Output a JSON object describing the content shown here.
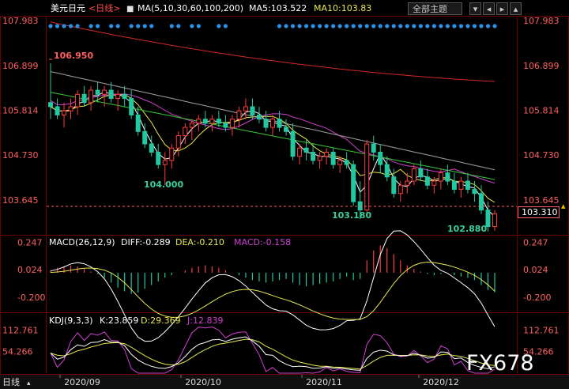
{
  "header": {
    "symbol": "美元日元",
    "period_link": "<日线>",
    "ma_label": "MA(5,10,30,60,100,200)",
    "ma5_label": "MA5:103.522",
    "ma10_label": "MA10:103.83",
    "theme_button": "全部主题",
    "window_buttons": [
      "▾",
      "◂",
      "▸",
      "▴"
    ]
  },
  "main_panel": {
    "y_ticks": [
      "107.983",
      "106.899",
      "105.814",
      "104.730",
      "103.645"
    ],
    "high_label": "106.950",
    "low_labels": [
      "104.000",
      "103.180",
      "102.880"
    ],
    "current_price": "103.310"
  },
  "macd_panel": {
    "title": "MACD(26,12,9)",
    "diff": "DIFF:-0.289",
    "dea": "DEA:-0.210",
    "macd": "MACD:-0.158",
    "y_ticks": [
      "0.247",
      "0.024",
      "-0.200"
    ]
  },
  "kdj_panel": {
    "title": "KDJ(9,3,3)",
    "k": "K:23.859",
    "d": "D:29.369",
    "j": "J:12.839",
    "y_ticks": [
      "112.761",
      "54.266"
    ]
  },
  "footer": {
    "period_tab": "日线",
    "x_labels": [
      "2020/09",
      "2020/10",
      "2020/11",
      "2020/12"
    ],
    "watermark": "FX678"
  },
  "colors": {
    "up": "#ff3c3c",
    "down": "#22c8a0",
    "ma5": "#ffffff",
    "ma10": "#e8e84a",
    "ma30": "#d040d0",
    "ma60": "#35c835",
    "ma100": "#a0a0a0",
    "ma200": "#d02828",
    "axis_text": "#ff6060",
    "grid": "#5a0000"
  },
  "chart_data": [
    {
      "type": "candlestick",
      "title": "美元日元 <日线>",
      "x_labels": [
        "2020/09",
        "2020/10",
        "2020/11",
        "2020/12"
      ],
      "ylim": [
        102.8,
        108.1
      ],
      "annotations": [
        {
          "text": "106.950",
          "value": 106.95
        },
        {
          "text": "104.000",
          "value": 104.0
        },
        {
          "text": "103.180",
          "value": 103.18
        },
        {
          "text": "102.880",
          "value": 102.88
        }
      ],
      "ohlc": [
        [
          106.0,
          106.95,
          105.6,
          105.9
        ],
        [
          105.9,
          106.1,
          105.6,
          105.7
        ],
        [
          105.7,
          106.0,
          105.4,
          105.8
        ],
        [
          105.8,
          106.1,
          105.6,
          105.9
        ],
        [
          105.9,
          106.3,
          105.7,
          106.2
        ],
        [
          106.2,
          106.4,
          105.9,
          106.0
        ],
        [
          106.0,
          106.4,
          105.8,
          106.3
        ],
        [
          106.3,
          106.5,
          106.0,
          106.2
        ],
        [
          106.2,
          106.4,
          105.9,
          106.3
        ],
        [
          106.3,
          106.5,
          106.0,
          106.1
        ],
        [
          106.1,
          106.3,
          105.8,
          106.2
        ],
        [
          106.2,
          106.4,
          105.9,
          106.1
        ],
        [
          106.1,
          106.3,
          105.6,
          105.7
        ],
        [
          105.7,
          105.9,
          105.2,
          105.3
        ],
        [
          105.3,
          105.5,
          104.9,
          105.0
        ],
        [
          105.0,
          105.2,
          104.7,
          104.8
        ],
        [
          104.8,
          105.0,
          104.4,
          104.5
        ],
        [
          104.5,
          104.8,
          104.0,
          104.6
        ],
        [
          104.6,
          105.0,
          104.4,
          104.9
        ],
        [
          104.9,
          105.3,
          104.7,
          105.2
        ],
        [
          105.2,
          105.5,
          105.0,
          105.4
        ],
        [
          105.4,
          105.6,
          105.1,
          105.5
        ],
        [
          105.5,
          105.7,
          105.3,
          105.6
        ],
        [
          105.6,
          105.8,
          105.4,
          105.5
        ],
        [
          105.5,
          105.7,
          105.3,
          105.6
        ],
        [
          105.6,
          105.8,
          105.4,
          105.5
        ],
        [
          105.5,
          105.7,
          105.3,
          105.4
        ],
        [
          105.4,
          105.7,
          105.2,
          105.6
        ],
        [
          105.6,
          105.9,
          105.4,
          105.8
        ],
        [
          105.8,
          106.1,
          105.6,
          105.9
        ],
        [
          105.9,
          106.1,
          105.6,
          105.7
        ],
        [
          105.7,
          105.9,
          105.5,
          105.6
        ],
        [
          105.6,
          105.8,
          105.3,
          105.4
        ],
        [
          105.4,
          105.7,
          105.2,
          105.6
        ],
        [
          105.6,
          105.8,
          105.3,
          105.4
        ],
        [
          105.4,
          105.6,
          105.2,
          105.3
        ],
        [
          105.3,
          105.5,
          104.6,
          104.7
        ],
        [
          104.7,
          105.0,
          104.5,
          104.9
        ],
        [
          104.9,
          105.1,
          104.6,
          104.8
        ],
        [
          104.8,
          105.0,
          104.5,
          104.6
        ],
        [
          104.6,
          104.8,
          104.4,
          104.7
        ],
        [
          104.7,
          104.9,
          104.5,
          104.8
        ],
        [
          104.8,
          104.9,
          104.4,
          104.5
        ],
        [
          104.5,
          104.7,
          104.3,
          104.6
        ],
        [
          104.6,
          104.8,
          104.4,
          104.5
        ],
        [
          104.5,
          104.6,
          103.5,
          103.6
        ],
        [
          103.6,
          104.1,
          103.18,
          103.4
        ],
        [
          103.4,
          105.1,
          103.3,
          105.0
        ],
        [
          105.0,
          105.2,
          104.6,
          104.8
        ],
        [
          104.8,
          105.0,
          104.3,
          104.5
        ],
        [
          104.5,
          104.7,
          104.1,
          104.2
        ],
        [
          104.2,
          104.4,
          103.7,
          103.8
        ],
        [
          103.8,
          104.1,
          103.6,
          104.0
        ],
        [
          104.0,
          104.3,
          103.8,
          104.1
        ],
        [
          104.1,
          104.5,
          104.0,
          104.4
        ],
        [
          104.4,
          104.6,
          104.1,
          104.2
        ],
        [
          104.2,
          104.4,
          103.9,
          104.0
        ],
        [
          104.0,
          104.2,
          103.8,
          104.1
        ],
        [
          104.1,
          104.4,
          103.9,
          104.3
        ],
        [
          104.3,
          104.5,
          104.0,
          104.1
        ],
        [
          104.1,
          104.3,
          103.8,
          103.9
        ],
        [
          103.9,
          104.2,
          103.7,
          104.1
        ],
        [
          104.1,
          104.3,
          103.8,
          103.9
        ],
        [
          103.9,
          104.1,
          103.6,
          103.8
        ],
        [
          103.8,
          104.0,
          103.3,
          103.4
        ],
        [
          103.4,
          103.6,
          102.88,
          103.0
        ],
        [
          103.0,
          103.4,
          102.9,
          103.31
        ]
      ],
      "series": [
        {
          "name": "MA5",
          "values": [
            103.522
          ]
        },
        {
          "name": "MA10",
          "values": [
            103.83
          ]
        }
      ]
    },
    {
      "type": "bar",
      "title": "MACD(26,12,9)",
      "series": [
        {
          "name": "DIFF",
          "last": -0.289
        },
        {
          "name": "DEA",
          "last": -0.21
        },
        {
          "name": "MACD",
          "last": -0.158
        }
      ],
      "ylim": [
        -0.32,
        0.3
      ],
      "y_ticks": [
        0.247,
        0.024,
        -0.2
      ],
      "macd_hist": [
        0.02,
        0.04,
        0.05,
        0.06,
        0.05,
        0.03,
        0.01,
        -0.01,
        -0.04,
        -0.08,
        -0.12,
        -0.15,
        -0.17,
        -0.16,
        -0.13,
        -0.1,
        -0.07,
        -0.04,
        -0.02,
        0.0,
        0.02,
        0.04,
        0.05,
        0.06,
        0.05,
        0.04,
        0.02,
        0.0,
        -0.02,
        -0.04,
        -0.06,
        -0.07,
        -0.08,
        -0.07,
        -0.06,
        -0.05,
        -0.08,
        -0.1,
        -0.11,
        -0.1,
        -0.09,
        -0.08,
        -0.07,
        -0.05,
        -0.03,
        -0.06,
        -0.05,
        0.1,
        0.18,
        0.22,
        0.2,
        0.15,
        0.1,
        0.06,
        0.03,
        0.01,
        -0.01,
        -0.02,
        -0.01,
        0.0,
        -0.02,
        -0.03,
        -0.04,
        -0.06,
        -0.1,
        -0.14,
        -0.158
      ]
    },
    {
      "type": "line",
      "title": "KDJ(9,3,3)",
      "series": [
        {
          "name": "K",
          "last": 23.859
        },
        {
          "name": "D",
          "last": 29.369
        },
        {
          "name": "J",
          "last": 12.839
        }
      ],
      "ylim": [
        -5,
        125
      ],
      "y_ticks": [
        112.761,
        54.266
      ]
    }
  ]
}
